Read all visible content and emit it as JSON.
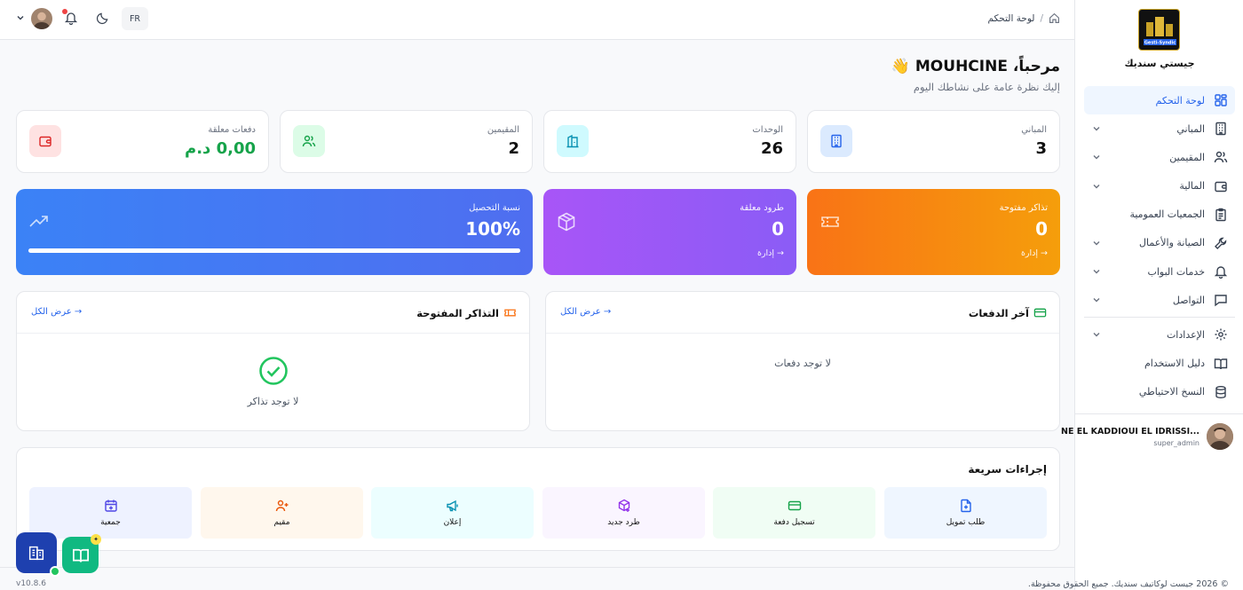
{
  "app": {
    "brand_name": "جيستي سنديك",
    "logo_text": "Gesti-Syndic"
  },
  "colors": {
    "primary": "#2563eb",
    "orange": "#f97316",
    "purple": "#a855f7",
    "blue": "#3b82f6",
    "green": "#16a34a"
  },
  "sidebar": {
    "items": [
      {
        "label": "لوحة التحكم",
        "icon": "dashboard-icon",
        "active": true
      },
      {
        "label": "المباني",
        "icon": "building-icon",
        "expandable": true
      },
      {
        "label": "المقيمين",
        "icon": "users-icon",
        "expandable": true
      },
      {
        "label": "المالية",
        "icon": "wallet-icon",
        "expandable": true
      },
      {
        "label": "الجمعيات العمومية",
        "icon": "clipboard-icon"
      },
      {
        "label": "الصيانة والأعمال",
        "icon": "wrench-icon",
        "expandable": true
      },
      {
        "label": "خدمات البواب",
        "icon": "bell-icon",
        "expandable": true
      },
      {
        "label": "التواصل",
        "icon": "message-icon",
        "expandable": true
      },
      {
        "label": "الإعدادات",
        "icon": "gear-icon",
        "expandable": true
      },
      {
        "label": "دليل الاستخدام",
        "icon": "book-icon"
      },
      {
        "label": "النسخ الاحتياطي",
        "icon": "database-icon"
      }
    ],
    "user": {
      "name": "NE EL KADDIOUI EL IDRISSI...",
      "role": "super_admin"
    }
  },
  "topbar": {
    "lang": "FR",
    "breadcrumb_page": "لوحة التحكم",
    "breadcrumb_sep": "/"
  },
  "welcome": {
    "title": "مرحباً، MOUHCINE 👋",
    "subtitle": "إليك نظرة عامة على نشاطك اليوم"
  },
  "stats": [
    {
      "label": "المباني",
      "value": "3"
    },
    {
      "label": "الوحدات",
      "value": "26"
    },
    {
      "label": "المقيمين",
      "value": "2"
    },
    {
      "label": "دفعات معلقة",
      "value": "0,00 د.م"
    }
  ],
  "highlights": {
    "tickets": {
      "label": "تذاكر مفتوحة",
      "value": "0",
      "link": "إدارة →"
    },
    "parcels": {
      "label": "طرود معلقة",
      "value": "0",
      "link": "إدارة →"
    },
    "collection": {
      "label": "نسبة التحصيل",
      "value": "100%",
      "progress": 100
    }
  },
  "panels": {
    "payments": {
      "title": "آخر الدفعات",
      "link": "عرض الكل →",
      "empty": "لا توجد دفعات"
    },
    "tickets": {
      "title": "التذاكر المفتوحة",
      "link": "عرض الكل →",
      "empty": "لا توجد تذاكر"
    }
  },
  "quick_actions": {
    "title": "إجراءات سريعة",
    "items": [
      {
        "label": "طلب تمويل",
        "icon": "file-plus-icon"
      },
      {
        "label": "تسجيل دفعة",
        "icon": "credit-card-icon"
      },
      {
        "label": "طرد جديد",
        "icon": "package-plus-icon"
      },
      {
        "label": "إعلان",
        "icon": "megaphone-icon"
      },
      {
        "label": "مقيم",
        "icon": "user-plus-icon"
      },
      {
        "label": "جمعية",
        "icon": "calendar-plus-icon"
      }
    ]
  },
  "footer": {
    "version": "v10.8.6",
    "copyright": "© 2026 جيست لوكاتيف سنديك. جميع الحقوق محفوظة."
  }
}
